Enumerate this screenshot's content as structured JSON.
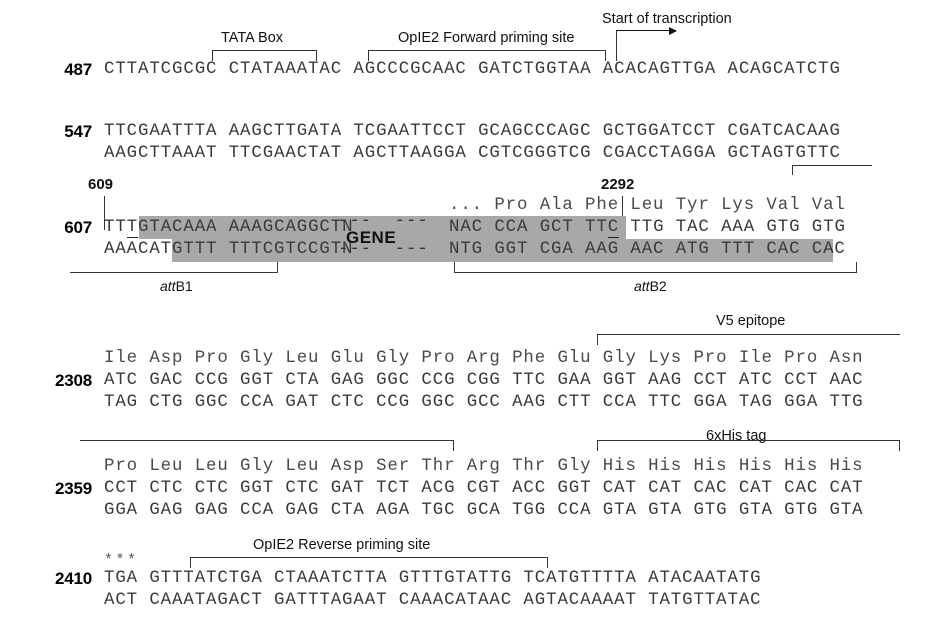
{
  "figure": {
    "type": "dna-sequence-map",
    "description": "Annotated double-stranded DNA sequence map of an expression vector region"
  },
  "annotations": {
    "tata_box": "TATA Box",
    "opie2_forward": "OpIE2 Forward priming site",
    "start_of_transcription": "Start of transcription",
    "attb1": "attB1",
    "attb1_italic": "att",
    "attb1_plain": "B1",
    "attb2_italic": "att",
    "attb2_plain": "B2",
    "v5_epitope": "V5 epitope",
    "his_tag": "6xHis tag",
    "opie2_reverse": "OpIE2 Reverse priming site",
    "gene_label": "GENE",
    "gene_dash_top": "---  ---",
    "gene_dash_bottom": "---  ---",
    "stop_stars": "***",
    "marker_609": "609",
    "marker_2292": "2292"
  },
  "blocks": [
    {
      "index": "487",
      "top_strand": "CTTATCGCGC CTATAAATAC AGCCCGCAAC GATCTGGTAA ACACAGTTGA ACAGCATCTG",
      "bottom_strand": "",
      "amino_acids": ""
    },
    {
      "index": "547",
      "top_strand": "TTCGAATTTA AAGCTTGATA TCGAATTCCT GCAGCCCAGC GCTGGATCCT CGATCACAAG",
      "bottom_strand": "AAGCTTAAAT TTCGAACTAT AGCTTAAGGA CGTCGGGTCG CGACCTAGGA GCTAGTGTTC",
      "amino_acids": ""
    },
    {
      "index": "607",
      "top_strand_pre": "TTT",
      "top_strand": "TTTGTACAAA AAAGCAGGCTN",
      "top_strand_post": "NAC CCA GCT TTC TTG TAC AAA GTG GTG",
      "bottom_strand": "AAACATGTTT TTTCGTCCGTN",
      "bottom_strand_post": "NTG GGT CGA AAG AAC ATG TTT CAC CAC",
      "amino_acids": "... Pro Ala Phe Leu Tyr Lys Val Val"
    },
    {
      "index": "2308",
      "amino_acids": "Ile Asp Pro Gly Leu Glu Gly Pro Arg Phe Glu Gly Lys Pro Ile Pro Asn",
      "top_strand": "ATC GAC CCG GGT CTA GAG GGC CCG CGG TTC GAA GGT AAG CCT ATC CCT AAC",
      "bottom_strand": "TAG CTG GGC CCA GAT CTC CCG GGC GCC AAG CTT CCA TTC GGA TAG GGA TTG"
    },
    {
      "index": "2359",
      "amino_acids": "Pro Leu Leu Gly Leu Asp Ser Thr Arg Thr Gly His His His His His His",
      "top_strand": "CCT CTC CTC GGT CTC GAT TCT ACG CGT ACC GGT CAT CAT CAC CAT CAC CAT",
      "bottom_strand": "GGA GAG GAG CCA GAG CTA AGA TGC GCA TGG CCA GTA GTA GTG GTA GTG GTA"
    },
    {
      "index": "2410",
      "amino_acids": "",
      "top_strand": "TGA GTTTATCTGA CTAAATCTTA GTTTGTATTG TCATGTTTTA ATACAATATG",
      "bottom_strand": "ACT CAAATAGACT GATTTAGAAT CAAACATAAC AGTACAAAAT TATGTTATAC"
    }
  ],
  "colors": {
    "shade": "#a8a8a8",
    "sequence_text": "#3a3a3a",
    "annotation_text": "#111111",
    "rule": "#333333",
    "background": "#ffffff"
  }
}
